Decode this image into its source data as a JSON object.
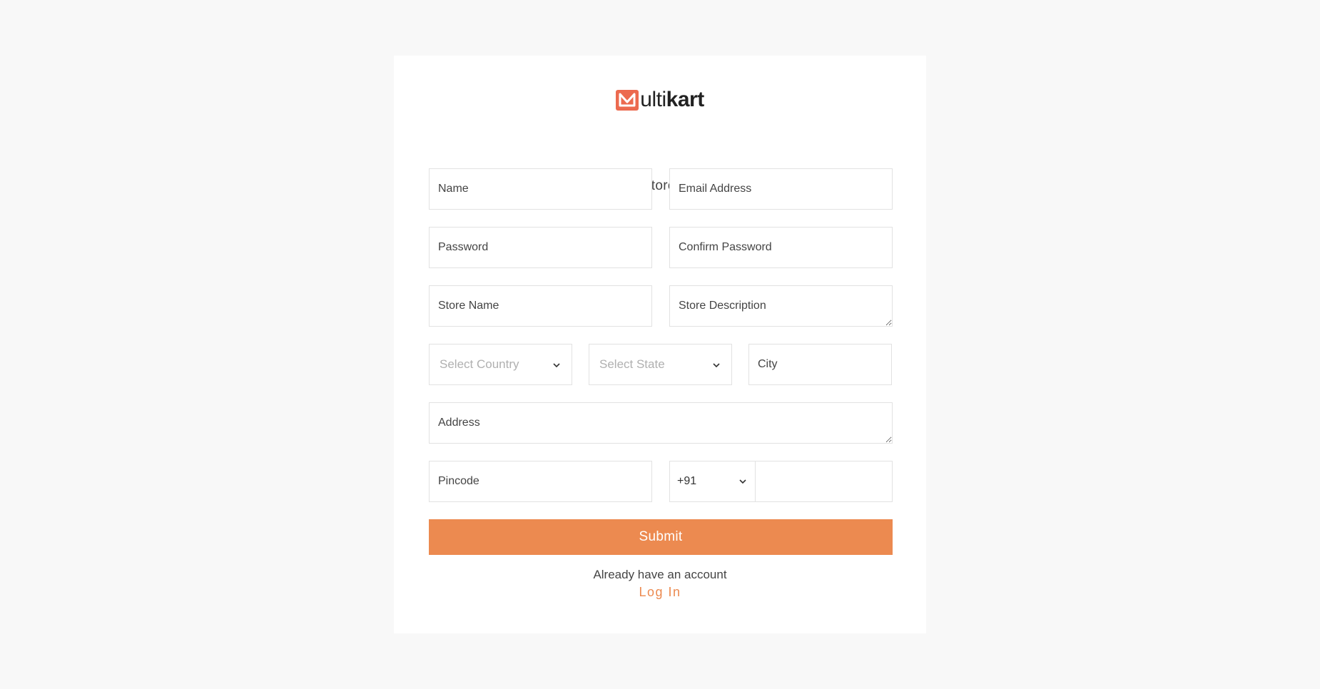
{
  "brand": {
    "name_prefix": "ulti",
    "name_bold": "kart",
    "accent_color": "#ec6a4f",
    "logo_icon": "m-logo-icon"
  },
  "subtitle": "setup_your_store_information",
  "form": {
    "name_placeholder": "Name",
    "email_placeholder": "Email Address",
    "password_placeholder": "Password",
    "confirm_password_placeholder": "Confirm Password",
    "store_name_placeholder": "Store Name",
    "store_description_placeholder": "Store Description",
    "country_select": "Select Country",
    "state_select": "Select State",
    "city_placeholder": "City",
    "address_placeholder": "Address",
    "pincode_placeholder": "Pincode",
    "phone_code": "+91",
    "phone_value": "",
    "submit_label": "Submit",
    "submit_color": "#ec8a50"
  },
  "footer": {
    "already_text": "Already have an account",
    "login_label": "Log In"
  }
}
